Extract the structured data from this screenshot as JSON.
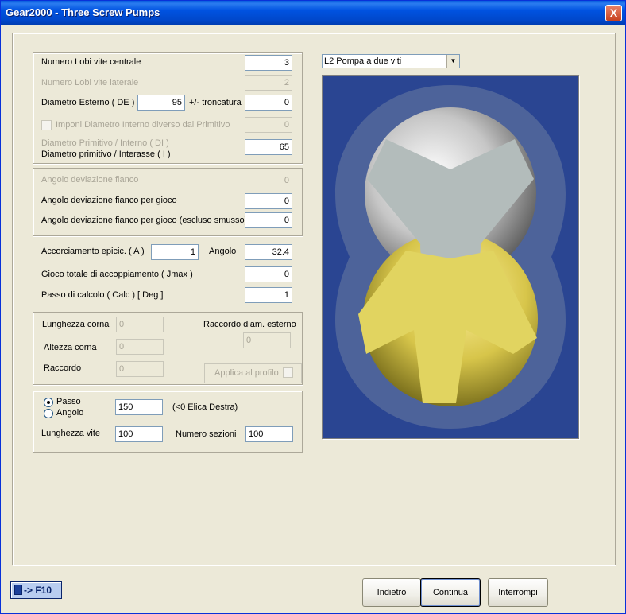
{
  "window": {
    "title": "Gear2000 - Three Screw Pumps",
    "close_glyph": "X"
  },
  "group1": {
    "lobi_centrale": {
      "label": "Numero Lobi vite centrale",
      "value": "3"
    },
    "lobi_laterale": {
      "label": "Numero Lobi vite laterale",
      "value": "2"
    },
    "diametro_esterno": {
      "label": "Diametro Esterno ( DE )",
      "value": "95"
    },
    "troncatura": {
      "label": "+/- troncatura",
      "value": "0"
    },
    "imponi": {
      "label": "Imponi Diametro Interno diverso dal Primitivo",
      "value": "0"
    },
    "primitivo_interno": {
      "label": "Diametro Primitivo / Interno  ( DI )"
    },
    "interasse": {
      "label": "Diametro primitivo / Interasse ( I )",
      "value": "65"
    }
  },
  "group2": {
    "angolo_dev": {
      "label": "Angolo deviazione fianco",
      "value": "0"
    },
    "angolo_gioco": {
      "label": "Angolo deviazione fianco per gioco",
      "value": "0"
    },
    "angolo_gioco_smusso": {
      "label": "Angolo deviazione fianco per gioco (escluso smusso)",
      "value": "0"
    }
  },
  "group3": {
    "accorciamento": {
      "label": "Accorciamento epicic. ( A )",
      "value": "1"
    },
    "angolo": {
      "label": "Angolo",
      "value": "32.4"
    },
    "gioco_totale": {
      "label": "Gioco totale di accoppiamento ( Jmax )",
      "value": "0"
    },
    "passo_calcolo": {
      "label": "Passo di calcolo ( Calc ) [ Deg ]",
      "value": "1"
    }
  },
  "group4": {
    "lunghezza_corna": {
      "label": "Lunghezza corna",
      "value": "0"
    },
    "altezza_corna": {
      "label": "Altezza corna",
      "value": "0"
    },
    "raccordo": {
      "label": "Raccordo",
      "value": "0"
    },
    "raccordo_diam": {
      "label": "Raccordo diam. esterno",
      "value": "0"
    },
    "applica": {
      "label": "Applica al profilo"
    }
  },
  "group5": {
    "passo": {
      "label": "Passo"
    },
    "angolo": {
      "label": "Angolo"
    },
    "passo_value": "150",
    "elica_note": "(<0 Elica Destra)",
    "lunghezza_vite": {
      "label": "Lunghezza vite",
      "value": "100"
    },
    "numero_sezioni": {
      "label": "Numero sezioni",
      "value": "100"
    }
  },
  "preview": {
    "combo_value": "L2 Pompa a due viti",
    "colors": {
      "background": "#2a4592",
      "housing": "#4d639a",
      "upper_rotor": "#b3bcbb",
      "lower_rotor": "#e1d460"
    }
  },
  "footer": {
    "f10_label": "-> F10",
    "indietro": "Indietro",
    "continua": "Continua",
    "interrompi": "Interrompi"
  }
}
